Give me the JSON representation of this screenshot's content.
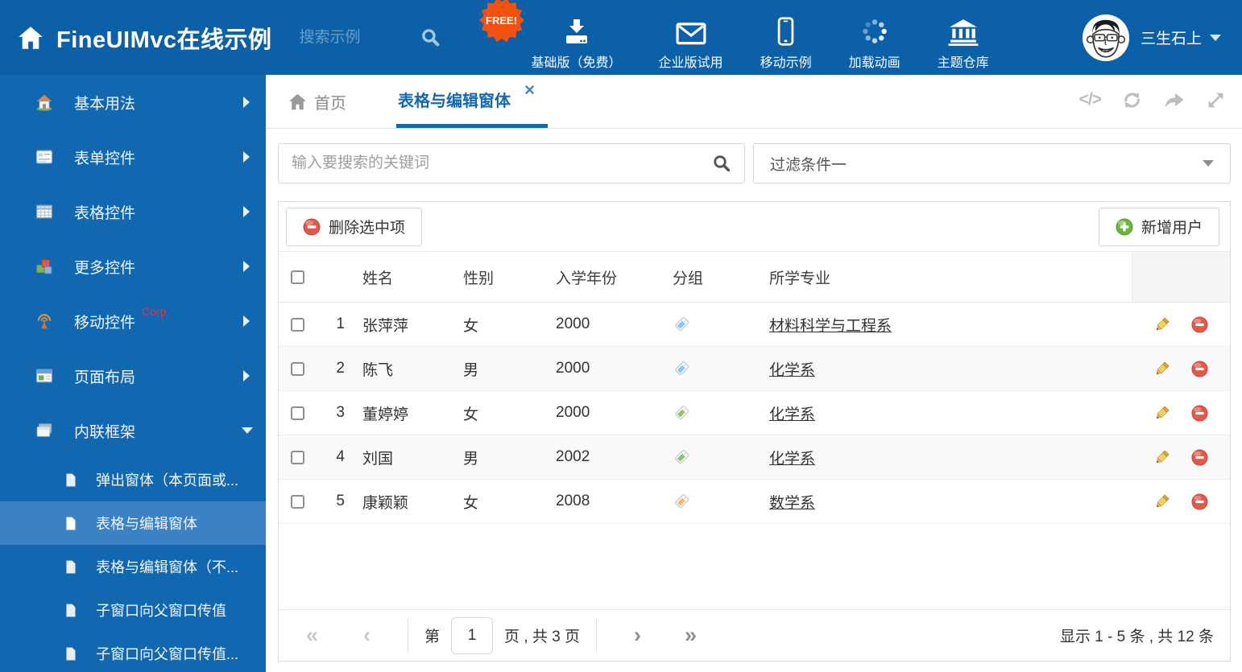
{
  "header": {
    "title": "FineUIMvc在线示例",
    "search_placeholder": "搜索示例",
    "free_badge": "FREE!",
    "nav": [
      {
        "label": "基础版（免费）",
        "icon": "download-icon"
      },
      {
        "label": "企业版试用",
        "icon": "envelope-icon"
      },
      {
        "label": "移动示例",
        "icon": "phone-icon"
      },
      {
        "label": "加载动画",
        "icon": "spinner-icon"
      },
      {
        "label": "主题仓库",
        "icon": "bank-icon"
      }
    ],
    "user_name": "三生石上"
  },
  "sidebar": {
    "items": [
      {
        "label": "基本用法"
      },
      {
        "label": "表单控件"
      },
      {
        "label": "表格控件"
      },
      {
        "label": "更多控件"
      },
      {
        "label": "移动控件",
        "badge": "Corp."
      },
      {
        "label": "页面布局"
      },
      {
        "label": "内联框架",
        "expanded": true
      }
    ],
    "subitems": [
      {
        "label": "弹出窗体（本页面或..."
      },
      {
        "label": "表格与编辑窗体",
        "selected": true
      },
      {
        "label": "表格与编辑窗体（不..."
      },
      {
        "label": "子窗口向父窗口传值"
      },
      {
        "label": "子窗口向父窗口传值..."
      }
    ]
  },
  "tabs": [
    {
      "label": "首页"
    },
    {
      "label": "表格与编辑窗体",
      "active": true
    }
  ],
  "filters": {
    "search_placeholder": "输入要搜索的关键词",
    "filter_value": "过滤条件一"
  },
  "toolbar": {
    "delete_label": "删除选中项",
    "add_label": "新增用户"
  },
  "table": {
    "columns": [
      "姓名",
      "性别",
      "入学年份",
      "分组",
      "所学专业"
    ],
    "rows": [
      {
        "num": "1",
        "name": "张萍萍",
        "gender": "女",
        "year": "2000",
        "tag_color": "#85C8F5",
        "major": "材料科学与工程系"
      },
      {
        "num": "2",
        "name": "陈飞",
        "gender": "男",
        "year": "2000",
        "tag_color": "#85C8F5",
        "major": "化学系"
      },
      {
        "num": "3",
        "name": "董婷婷",
        "gender": "女",
        "year": "2000",
        "tag_color": "#8FC46F",
        "major": "化学系"
      },
      {
        "num": "4",
        "name": "刘国",
        "gender": "男",
        "year": "2002",
        "tag_color": "#8FC46F",
        "major": "化学系"
      },
      {
        "num": "5",
        "name": "康颖颖",
        "gender": "女",
        "year": "2008",
        "tag_color": "#F8B973",
        "major": "数学系"
      }
    ]
  },
  "pagination": {
    "first_label": "第",
    "page": "1",
    "total_label": "页 , 共 3 页",
    "summary": "显示 1 - 5 条 , 共 12 条"
  },
  "colors": {
    "header_bg": "#0C60A8",
    "sidebar_bg": "#1268B0",
    "sidebar_selected": "#3B82C4",
    "accent": "#1269B0",
    "free_badge": "#F2510F",
    "delete_red": "#E4574B",
    "add_green": "#6CB43C"
  }
}
